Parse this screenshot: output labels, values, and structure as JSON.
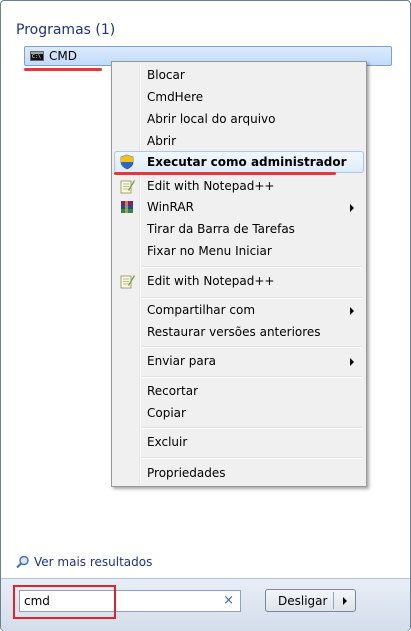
{
  "section_title": "Programas (1)",
  "result": {
    "label": "CMD",
    "icon": "cmd-console-icon"
  },
  "menu": {
    "items": {
      "blocar": "Blocar",
      "cmdhere": "CmdHere",
      "abrir_local": "Abrir local do arquivo",
      "abrir": "Abrir",
      "executar_admin": "Executar como administrador",
      "edit_notepad_1": "Edit with Notepad++",
      "winrar": "WinRAR",
      "tirar_barra": "Tirar da Barra de Tarefas",
      "fixar_menu": "Fixar no Menu Iniciar",
      "edit_notepad_2": "Edit with Notepad++",
      "compartilhar": "Compartilhar com",
      "restaurar": "Restaurar versões anteriores",
      "enviar": "Enviar para",
      "recortar": "Recortar",
      "copiar": "Copiar",
      "excluir": "Excluir",
      "propriedades": "Propriedades"
    }
  },
  "more_results": "Ver mais resultados",
  "search": {
    "value": "cmd",
    "clear": "×"
  },
  "shutdown": {
    "label": "Desligar"
  },
  "colors": {
    "highlight_red": "#e8343a",
    "link_blue": "#1e3287"
  }
}
